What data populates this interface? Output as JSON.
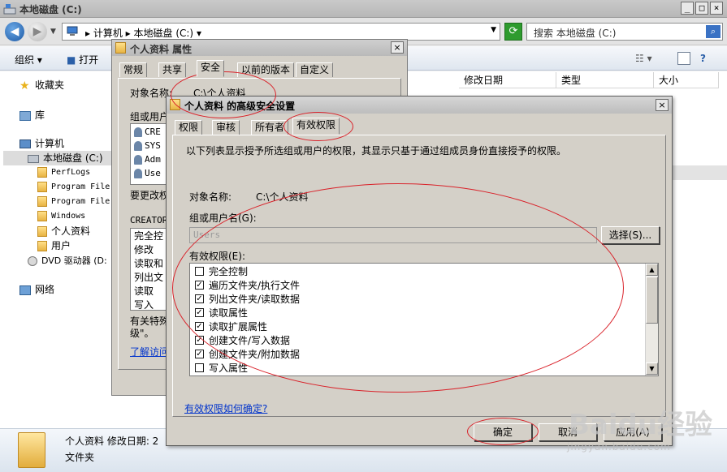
{
  "explorer": {
    "title": "本地磁盘 (C:)",
    "breadcrumb": [
      "计算机",
      "本地磁盘 (C:)"
    ],
    "search_placeholder": "搜索 本地磁盘 (C:)",
    "toolbar": {
      "organize": "组织",
      "open": "打开"
    },
    "nav": {
      "favorites": "收藏夹",
      "library": "库",
      "computer": "计算机",
      "drive_c": "本地磁盘 (C:)",
      "folders": [
        "PerfLogs",
        "Program File",
        "Program File",
        "Windows",
        "个人资料",
        "用户"
      ],
      "dvd": "DVD 驱动器 (D:",
      "network": "网络"
    },
    "columns": {
      "modified": "修改日期",
      "type": "类型",
      "size": "大小"
    },
    "details": {
      "name_line": "个人资料 修改日期: 2",
      "type": "文件夹"
    }
  },
  "props": {
    "title": "个人资料 属性",
    "tabs": [
      "常规",
      "共享",
      "安全",
      "以前的版本",
      "自定义"
    ],
    "object_label": "对象名称:",
    "object_value": "C:\\个人资料",
    "group_label": "组或用户",
    "users": [
      "CRE",
      "SYS",
      "Adm",
      "Use"
    ],
    "change_label": "要更改权",
    "creator_label": "CREATOR",
    "perms": [
      "完全控",
      "修改",
      "读取和",
      "列出文",
      "读取",
      "写入"
    ],
    "special_text_1": "有关特殊",
    "special_text_2": "级\"。",
    "learn_link": "了解访问"
  },
  "adv": {
    "title": "个人资料 的高级安全设置",
    "tabs": [
      "权限",
      "审核",
      "所有者",
      "有效权限"
    ],
    "description": "以下列表显示授予所选组或用户的权限，其显示只基于通过组成员身份直接授予的权限。",
    "object_label": "对象名称:",
    "object_value": "C:\\个人资料",
    "group_label": "组或用户名(G):",
    "group_value": "Users",
    "select_button": "选择(S)...",
    "effective_label": "有效权限(E):",
    "permissions": [
      {
        "label": "完全控制",
        "checked": false
      },
      {
        "label": "遍历文件夹/执行文件",
        "checked": true
      },
      {
        "label": "列出文件夹/读取数据",
        "checked": true
      },
      {
        "label": "读取属性",
        "checked": true
      },
      {
        "label": "读取扩展属性",
        "checked": true
      },
      {
        "label": "创建文件/写入数据",
        "checked": true
      },
      {
        "label": "创建文件夹/附加数据",
        "checked": true
      },
      {
        "label": "写入属性",
        "checked": false
      }
    ],
    "help_link": "有效权限如何确定?",
    "ok_button": "确定",
    "cancel_button": "取消",
    "apply_button": "应用(A)"
  },
  "watermark": {
    "main": "Baidu经验",
    "sub": "jingyan.baidu.com"
  },
  "colors": {
    "annotation": "#d9222a",
    "link": "#0033cc"
  }
}
